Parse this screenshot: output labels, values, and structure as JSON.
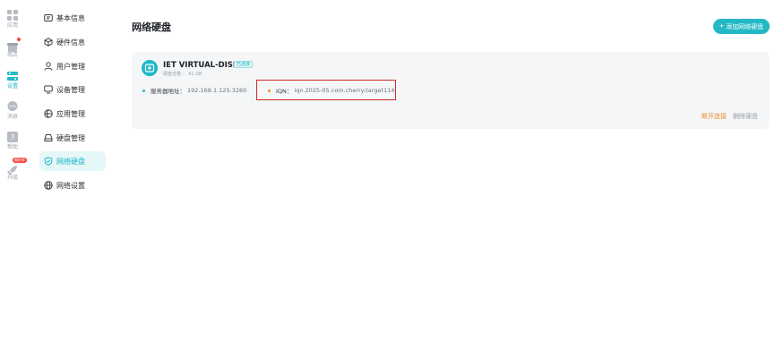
{
  "rail": {
    "items": [
      {
        "icon": "grid-icon",
        "label": "应用"
      },
      {
        "icon": "store-icon",
        "label": "商店"
      },
      {
        "icon": "settings-icon",
        "label": "设置"
      },
      {
        "icon": "chat-icon",
        "label": "消息"
      },
      {
        "icon": "help-icon",
        "label": "帮助"
      },
      {
        "icon": "rocket-icon",
        "label": "升级",
        "badge": "限时享"
      }
    ]
  },
  "sidebar": {
    "items": [
      {
        "label": "基本信息",
        "icon": "info-icon"
      },
      {
        "label": "硬件信息",
        "icon": "chip-icon"
      },
      {
        "label": "用户管理",
        "icon": "user-icon"
      },
      {
        "label": "设备管理",
        "icon": "monitor-icon"
      },
      {
        "label": "应用管理",
        "icon": "apps-icon"
      },
      {
        "label": "硬盘管理",
        "icon": "disk-icon"
      },
      {
        "label": "网络硬盘",
        "icon": "shield-icon"
      },
      {
        "label": "网络设置",
        "icon": "globe-icon"
      }
    ],
    "active_index": 6
  },
  "main": {
    "title": "网络硬盘",
    "add_button": "添加网络硬盘",
    "card": {
      "name": "IET VIRTUAL-DISK",
      "status": "已连接",
      "size_label": "硬盘容量：",
      "size_value": "41 GB",
      "server_label": "服务器地址：",
      "server_value": "192.168.1.125:3260",
      "iqn_label": "IQN：",
      "iqn_value": "iqn.2025-05.com.cherry:target114",
      "disconnect": "断开连接",
      "delete": "删除硬盘"
    }
  },
  "colors": {
    "accent": "#22b8c6",
    "alert": "#f2453d",
    "warning": "#f08a24",
    "highlight": "#d62828"
  }
}
